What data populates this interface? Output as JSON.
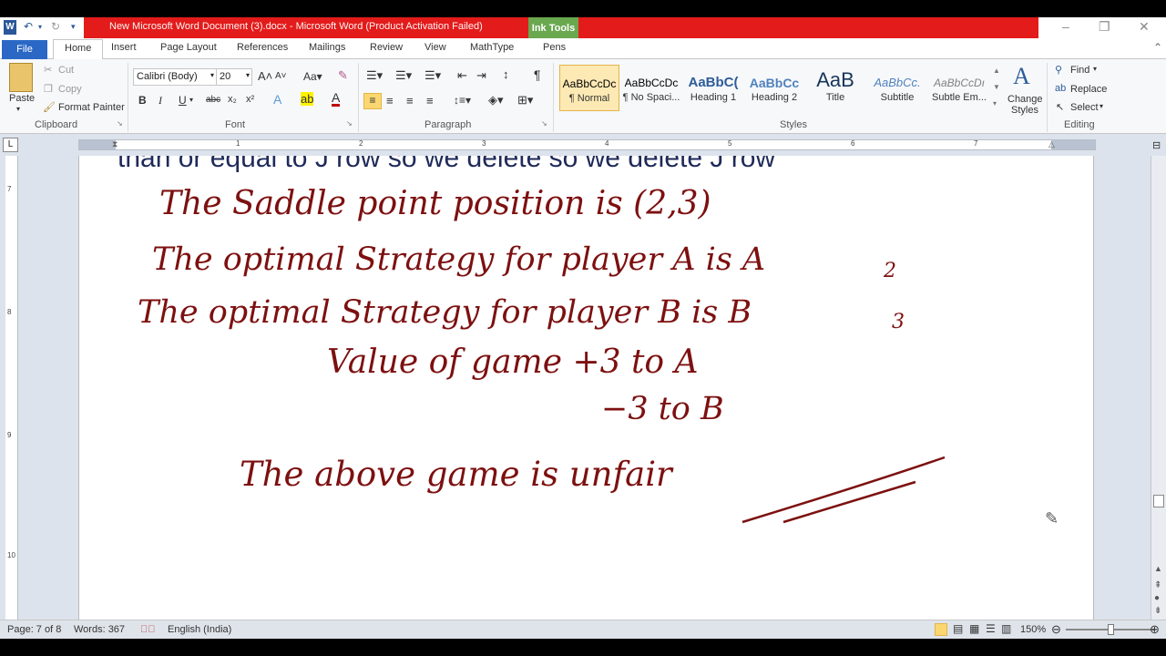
{
  "window": {
    "title": "New Microsoft Word Document (3).docx  -  Microsoft Word (Product Activation Failed)",
    "contextual_tab_header": "Ink Tools",
    "app_icon": "W",
    "controls": {
      "minimize": "–",
      "restore": "❐",
      "close": "✕"
    }
  },
  "tabs": [
    {
      "label": "File"
    },
    {
      "label": "Home"
    },
    {
      "label": "Insert"
    },
    {
      "label": "Page Layout"
    },
    {
      "label": "References"
    },
    {
      "label": "Mailings"
    },
    {
      "label": "Review"
    },
    {
      "label": "View"
    },
    {
      "label": "MathType"
    },
    {
      "label": "Pens"
    }
  ],
  "clipboard": {
    "paste": "Paste",
    "cut": "Cut",
    "copy": "Copy",
    "format_painter": "Format Painter",
    "label": "Clipboard"
  },
  "font": {
    "family": "Calibri (Body)",
    "size": "20",
    "label": "Font"
  },
  "paragraph": {
    "label": "Paragraph"
  },
  "styles": {
    "label": "Styles",
    "items": [
      {
        "preview": "AaBbCcDc",
        "name": "¶ Normal"
      },
      {
        "preview": "AaBbCcDc",
        "name": "¶ No Spaci..."
      },
      {
        "preview": "AaBbC(",
        "name": "Heading 1"
      },
      {
        "preview": "AaBbCc",
        "name": "Heading 2"
      },
      {
        "preview": "AaB",
        "name": "Title"
      },
      {
        "preview": "AaBbCc.",
        "name": "Subtitle"
      },
      {
        "preview": "AaBbCcDı",
        "name": "Subtle Em..."
      }
    ],
    "change_styles": "Change Styles"
  },
  "editing": {
    "find": "Find",
    "replace": "Replace",
    "select": "Select",
    "label": "Editing"
  },
  "ruler": {
    "ticks": [
      "1",
      "2",
      "3",
      "4",
      "5",
      "6",
      "7"
    ]
  },
  "vruler": {
    "ticks": [
      "7",
      "8",
      "9",
      "10"
    ]
  },
  "document": {
    "cut_text": "than or equal to J   row so we delete so we delete J   row",
    "ink_lines": [
      "The Saddle point position is (2,3)",
      "The optimal Strategy for player A is A",
      "2",
      "The optimal Strategy for player B is B",
      "3",
      "Value of game  +3  to A",
      "−3  to B",
      "The above game is unfair"
    ]
  },
  "status": {
    "page": "Page: 7 of 8",
    "words": "Words: 367",
    "language": "English (India)",
    "zoom": "150%"
  }
}
